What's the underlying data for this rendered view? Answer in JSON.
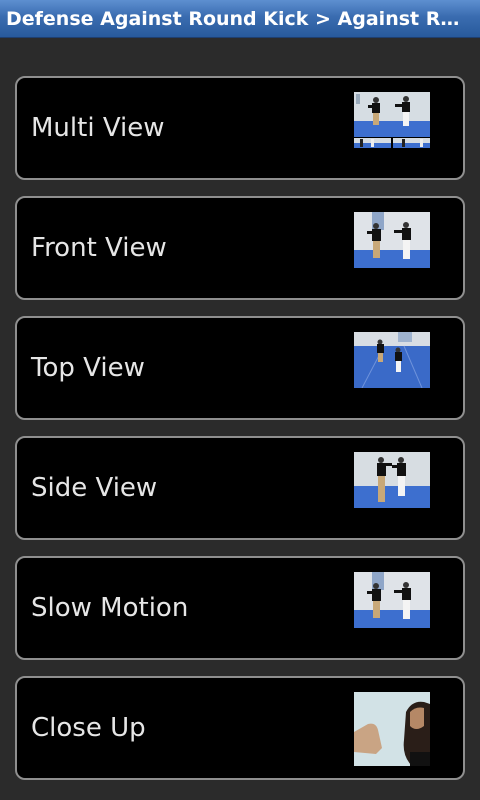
{
  "header": {
    "title": "Defense Against Round Kick > Against Round..."
  },
  "items": [
    {
      "label": "Multi View",
      "thumb": "multi-view-thumbnail"
    },
    {
      "label": "Front View",
      "thumb": "front-view-thumbnail"
    },
    {
      "label": "Top View",
      "thumb": "top-view-thumbnail"
    },
    {
      "label": "Side View",
      "thumb": "side-view-thumbnail"
    },
    {
      "label": "Slow Motion",
      "thumb": "slow-motion-thumbnail"
    },
    {
      "label": "Close Up",
      "thumb": "close-up-thumbnail"
    }
  ],
  "colors": {
    "title_bar": "#3a6cb0",
    "background": "#2b2b2b",
    "card": "#000000",
    "card_border": "#8f8f8f",
    "mat_blue": "#3c6fd1"
  }
}
